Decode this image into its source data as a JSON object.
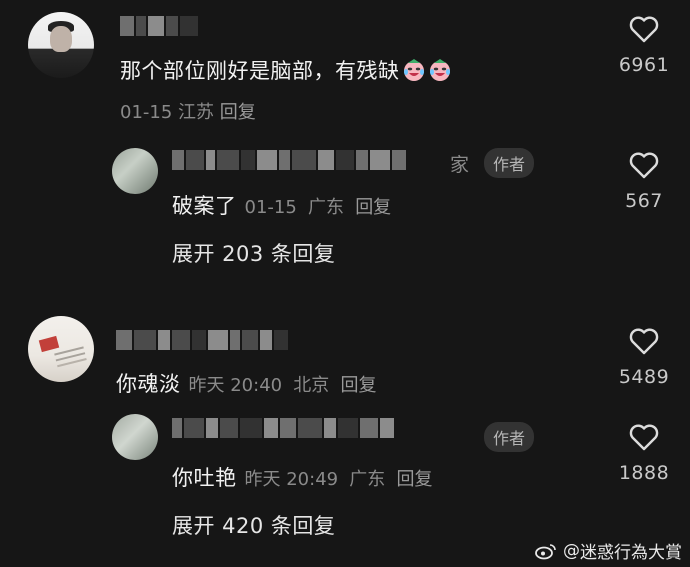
{
  "comments": [
    {
      "text": "那个部位刚好是脑部，有残缺",
      "date": "01-15",
      "location": "江苏",
      "reply_label": "回复",
      "likes": "6961",
      "emoji": [
        "crying-laughing-face",
        "crying-laughing-face"
      ]
    },
    {
      "name_suffix": "家",
      "badge": "作者",
      "text": "破案了",
      "date": "01-15",
      "location": "广东",
      "reply_label": "回复",
      "likes": "567",
      "expand_label": "展开 203 条回复"
    },
    {
      "text": "你魂淡",
      "date": "昨天 20:40",
      "location": "北京",
      "reply_label": "回复",
      "likes": "5489"
    },
    {
      "badge": "作者",
      "text": "你吐艳",
      "date": "昨天 20:49",
      "location": "广东",
      "reply_label": "回复",
      "likes": "1888",
      "expand_label": "展开 420 条回复"
    }
  ],
  "watermark": {
    "prefix": "@",
    "account": "迷惑行為大賞"
  },
  "colors": {
    "background": "#161616",
    "text": "#f2f2f2",
    "meta": "#8a8a8a",
    "badge_bg": "#333333"
  }
}
